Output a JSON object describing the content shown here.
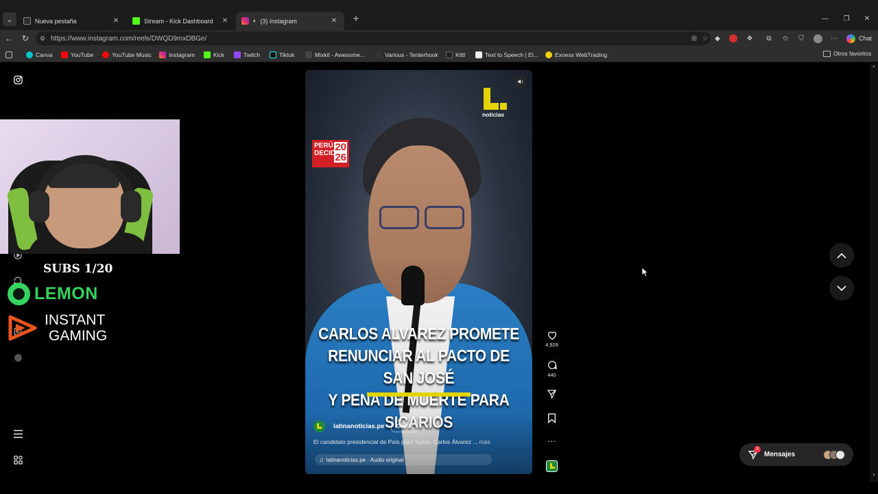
{
  "browser": {
    "tabs": [
      {
        "title": "Nueva pestaña",
        "favicon_color": "#2f2f2f"
      },
      {
        "title": "Stream - Kick Dashboard",
        "favicon_color": "#53fc18"
      },
      {
        "title": "(3) Instagram",
        "favicon_color": "#e1306c"
      }
    ],
    "new_tab_symbol": "+",
    "window_controls": {
      "minimize": "—",
      "maximize": "❐",
      "close": "✕"
    },
    "url": "https://www.instagram.com/reels/DWQD9mxDBGe/",
    "chat_label": "Chat",
    "bookmarks": [
      {
        "label": "Canva",
        "color": "#00c4cc"
      },
      {
        "label": "YouTube",
        "color": "#ff0000"
      },
      {
        "label": "YouTube Music",
        "color": "#ff0000"
      },
      {
        "label": "Instagram",
        "color": "#e1306c"
      },
      {
        "label": "Kick",
        "color": "#53fc18"
      },
      {
        "label": "Twitch",
        "color": "#9146ff"
      },
      {
        "label": "Tiktok",
        "color": "#111111"
      },
      {
        "label": "Mixkit - Awesome...",
        "color": "#444444"
      },
      {
        "label": "Various - Tenterhook",
        "color": "#333333"
      },
      {
        "label": "Kittl",
        "color": "#222222"
      },
      {
        "label": "Text to Speech | El...",
        "color": "#eeeeee"
      },
      {
        "label": "Exness WebTrading",
        "color": "#f5d000"
      }
    ],
    "other_bookmarks": "Otros favoritos"
  },
  "overlay": {
    "subs": "SUBS 1/20",
    "lemon": "LEMON",
    "instant_line1": "INSTANT",
    "instant_line2": "GAMING"
  },
  "reel": {
    "logo_text": "noticias",
    "badge_line1": "PERÚ",
    "badge_line2": "DECIDE",
    "badge_year_top": "20",
    "badge_year_bottom": "26",
    "headline_line1": "CARLOS ALVAREZ PROMETE",
    "headline_line2": "RENUNCIAR AL PACTO DE SAN JOSÉ",
    "headline_line3": "Y PENA DE MUERTE PARA SICARIOS",
    "account": "latinanoticias.pe",
    "follow_label": "Seguir",
    "caption": "El candidato presidencial de País para Todos, Carlos Álvarez ...",
    "more_label": "más",
    "audio": "latinanoticias.pe · Audio original"
  },
  "actions": {
    "likes": "4,926",
    "comments": "440"
  },
  "messages": {
    "label": "Mensajes",
    "badge": "3"
  },
  "colors": {
    "accent_yellow": "#e3d400",
    "suit_blue": "#2b7fc4",
    "lemon_green": "#33d35e",
    "badge_red": "#d31f26"
  }
}
